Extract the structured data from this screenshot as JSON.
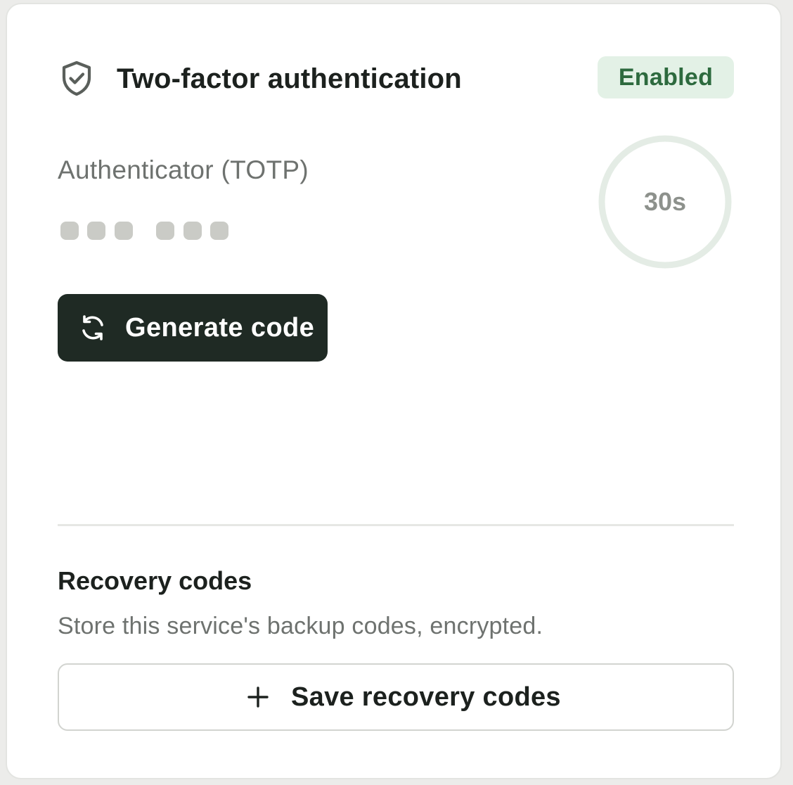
{
  "header": {
    "title": "Two-factor authentication",
    "status_badge": "Enabled",
    "icon": "shield-check-icon"
  },
  "totp": {
    "method_label": "Authenticator (TOTP)",
    "code_masked": true,
    "code_digit_count": 6,
    "timer_label": "30s",
    "timer_seconds_remaining": 30
  },
  "actions": {
    "generate_label": "Generate code",
    "generate_icon": "refresh-icon"
  },
  "recovery": {
    "title": "Recovery codes",
    "description": "Store this service's backup codes, encrypted.",
    "save_label": "Save recovery codes",
    "save_icon": "plus-icon"
  },
  "colors": {
    "badge_bg": "#e3f1e6",
    "badge_text": "#2d6a3e",
    "primary_button": "#1f2a24",
    "timer_ring": "#e4ece5"
  }
}
